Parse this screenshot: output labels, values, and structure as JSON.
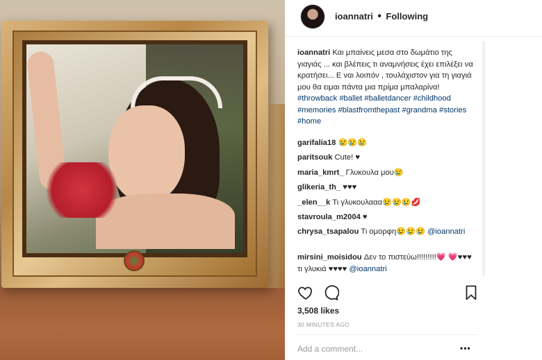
{
  "post": {
    "username": "ioannatri",
    "separator": "•",
    "follow_status": "Following",
    "caption": {
      "text": "Και μπαίνεις μεσα στο δωμάτιο της γιαγιάς ... και βλέπεις τι αναμνήσεις έχει επιλέξει να κρατήσει... Ε ναι λοιπόν , τουλάχιστον για τη γιαγιά μου θα ειμαι πάντα μια πρίμα μπαλαρίνα!",
      "hashtags": [
        "#throwback",
        "#ballet",
        "#balletdancer",
        "#childhood",
        "#memories",
        "#blastfromthepast",
        "#grandma",
        "#stories",
        "#home"
      ]
    },
    "comments": [
      {
        "user": "garifalia18",
        "text": "😢😢😢"
      },
      {
        "user": "paritsouk",
        "text": "Cute! ♥"
      },
      {
        "user": "maria_kmrt_",
        "text": "Γλυκουλα μου😢"
      },
      {
        "user": "glikeria_th_",
        "text": "♥♥♥"
      },
      {
        "user": "_elen__k",
        "text": "Τι γλυκουλααα😢😢😢💋"
      },
      {
        "user": "stavroula_m2004",
        "text": "♥"
      },
      {
        "user": "chrysa_tsapalou",
        "text": "Τι ομορφη😢😢😢",
        "mention": "@ioannatri"
      },
      {
        "user": "mirsini_moisidou",
        "text": "Δεν το πιστεύω!!!!!!!!!💗 💗♥♥♥ τι γλυκιά ♥♥♥♥",
        "mention": "@ioannatri"
      }
    ],
    "likes": "3,508 likes",
    "time": "30 MINUTES AGO",
    "add_comment_placeholder": "Add a comment...",
    "more_label": "•••"
  },
  "icons": {
    "like": "heart-icon",
    "comment": "comment-icon",
    "save": "bookmark-icon",
    "more": "ellipsis-icon"
  },
  "colors": {
    "link": "#003569",
    "text": "#262626",
    "muted": "#999999"
  }
}
